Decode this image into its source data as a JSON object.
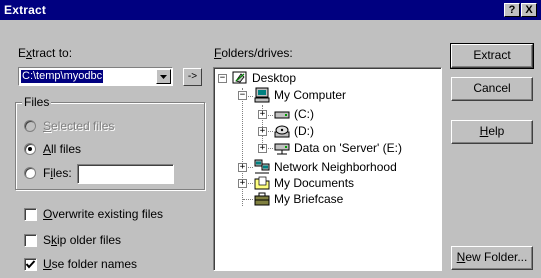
{
  "window": {
    "title": "Extract",
    "help_btn": "?",
    "close_btn": "X"
  },
  "extract_to": {
    "label_pre": "E",
    "label_u": "x",
    "label_post": "tract to:",
    "value": "C:\\temp\\myodbc",
    "arrow_btn": "->"
  },
  "files_group": {
    "title": "Files",
    "selected_pre": "",
    "selected_u": "S",
    "selected_post": "elected files",
    "all_pre": "",
    "all_u": "A",
    "all_post": "ll files",
    "files_pre": "F",
    "files_u": "i",
    "files_post": "les:",
    "files_value": "",
    "selected_option": "all"
  },
  "options": {
    "overwrite_pre": "",
    "overwrite_u": "O",
    "overwrite_post": "verwrite existing files",
    "overwrite_checked": false,
    "skip_pre": "S",
    "skip_u": "k",
    "skip_post": "ip older files",
    "skip_checked": false,
    "folders_pre": "",
    "folders_u": "U",
    "folders_post": "se folder names",
    "folders_checked": true
  },
  "tree": {
    "label_pre": "",
    "label_u": "F",
    "label_post": "olders/drives:",
    "desktop": "Desktop",
    "my_computer": "My Computer",
    "c_drive": "(C:)",
    "d_drive": "(D:)",
    "e_drive": "Data on 'Server' (E:)",
    "network": "Network Neighborhood",
    "documents": "My Documents",
    "briefcase": "My Briefcase"
  },
  "buttons": {
    "extract": "Extract",
    "cancel": "Cancel",
    "help_pre": "",
    "help_u": "H",
    "help_post": "elp",
    "newfolder_pre": "",
    "newfolder_u": "N",
    "newfolder_post": "ew Folder..."
  },
  "icons": {
    "desktop": "desktop-icon",
    "computer": "computer-icon",
    "drive": "hard-drive-icon",
    "cdrom": "cd-drive-icon",
    "network_drive": "network-drive-icon",
    "network": "network-neighborhood-icon",
    "folder": "folder-icon",
    "briefcase": "briefcase-icon"
  },
  "colors": {
    "titlebar": "#000080",
    "face": "#c0c0c0",
    "highlight": "#000080"
  }
}
